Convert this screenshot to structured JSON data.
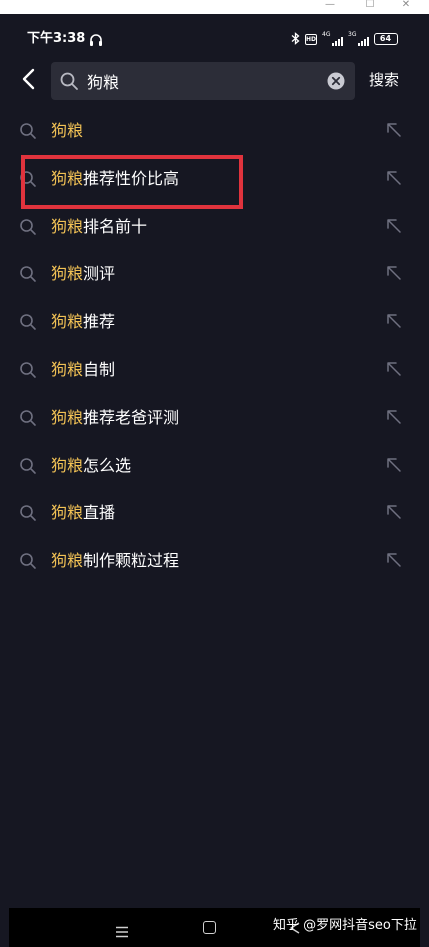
{
  "window_controls": {
    "minimize": "—",
    "maximize": "☐",
    "close": "✕"
  },
  "status_bar": {
    "time": "下午3:38",
    "network_1": "4G",
    "network_2": "3G",
    "battery": "64",
    "hd_label": "HD"
  },
  "search": {
    "query": "狗粮",
    "button_label": "搜索"
  },
  "suggestions": [
    {
      "highlight": "狗粮",
      "rest": ""
    },
    {
      "highlight": "狗粮",
      "rest": "推荐性价比高"
    },
    {
      "highlight": "狗粮",
      "rest": "排名前十"
    },
    {
      "highlight": "狗粮",
      "rest": "测评"
    },
    {
      "highlight": "狗粮",
      "rest": "推荐"
    },
    {
      "highlight": "狗粮",
      "rest": "自制"
    },
    {
      "highlight": "狗粮",
      "rest": "推荐老爸评测"
    },
    {
      "highlight": "狗粮",
      "rest": "怎么选"
    },
    {
      "highlight": "狗粮",
      "rest": "直播"
    },
    {
      "highlight": "狗粮",
      "rest": "制作颗粒过程"
    }
  ],
  "watermark": "知乎 @罗网抖音seo下拉",
  "colors": {
    "background": "#161722",
    "highlight": "#f2c255",
    "annotation": "#e0333d",
    "search_box": "#2c2d38"
  },
  "icons": {
    "back": "chevron-left-icon",
    "search": "search-icon",
    "clear": "clear-icon",
    "fill": "arrow-up-left-icon"
  }
}
